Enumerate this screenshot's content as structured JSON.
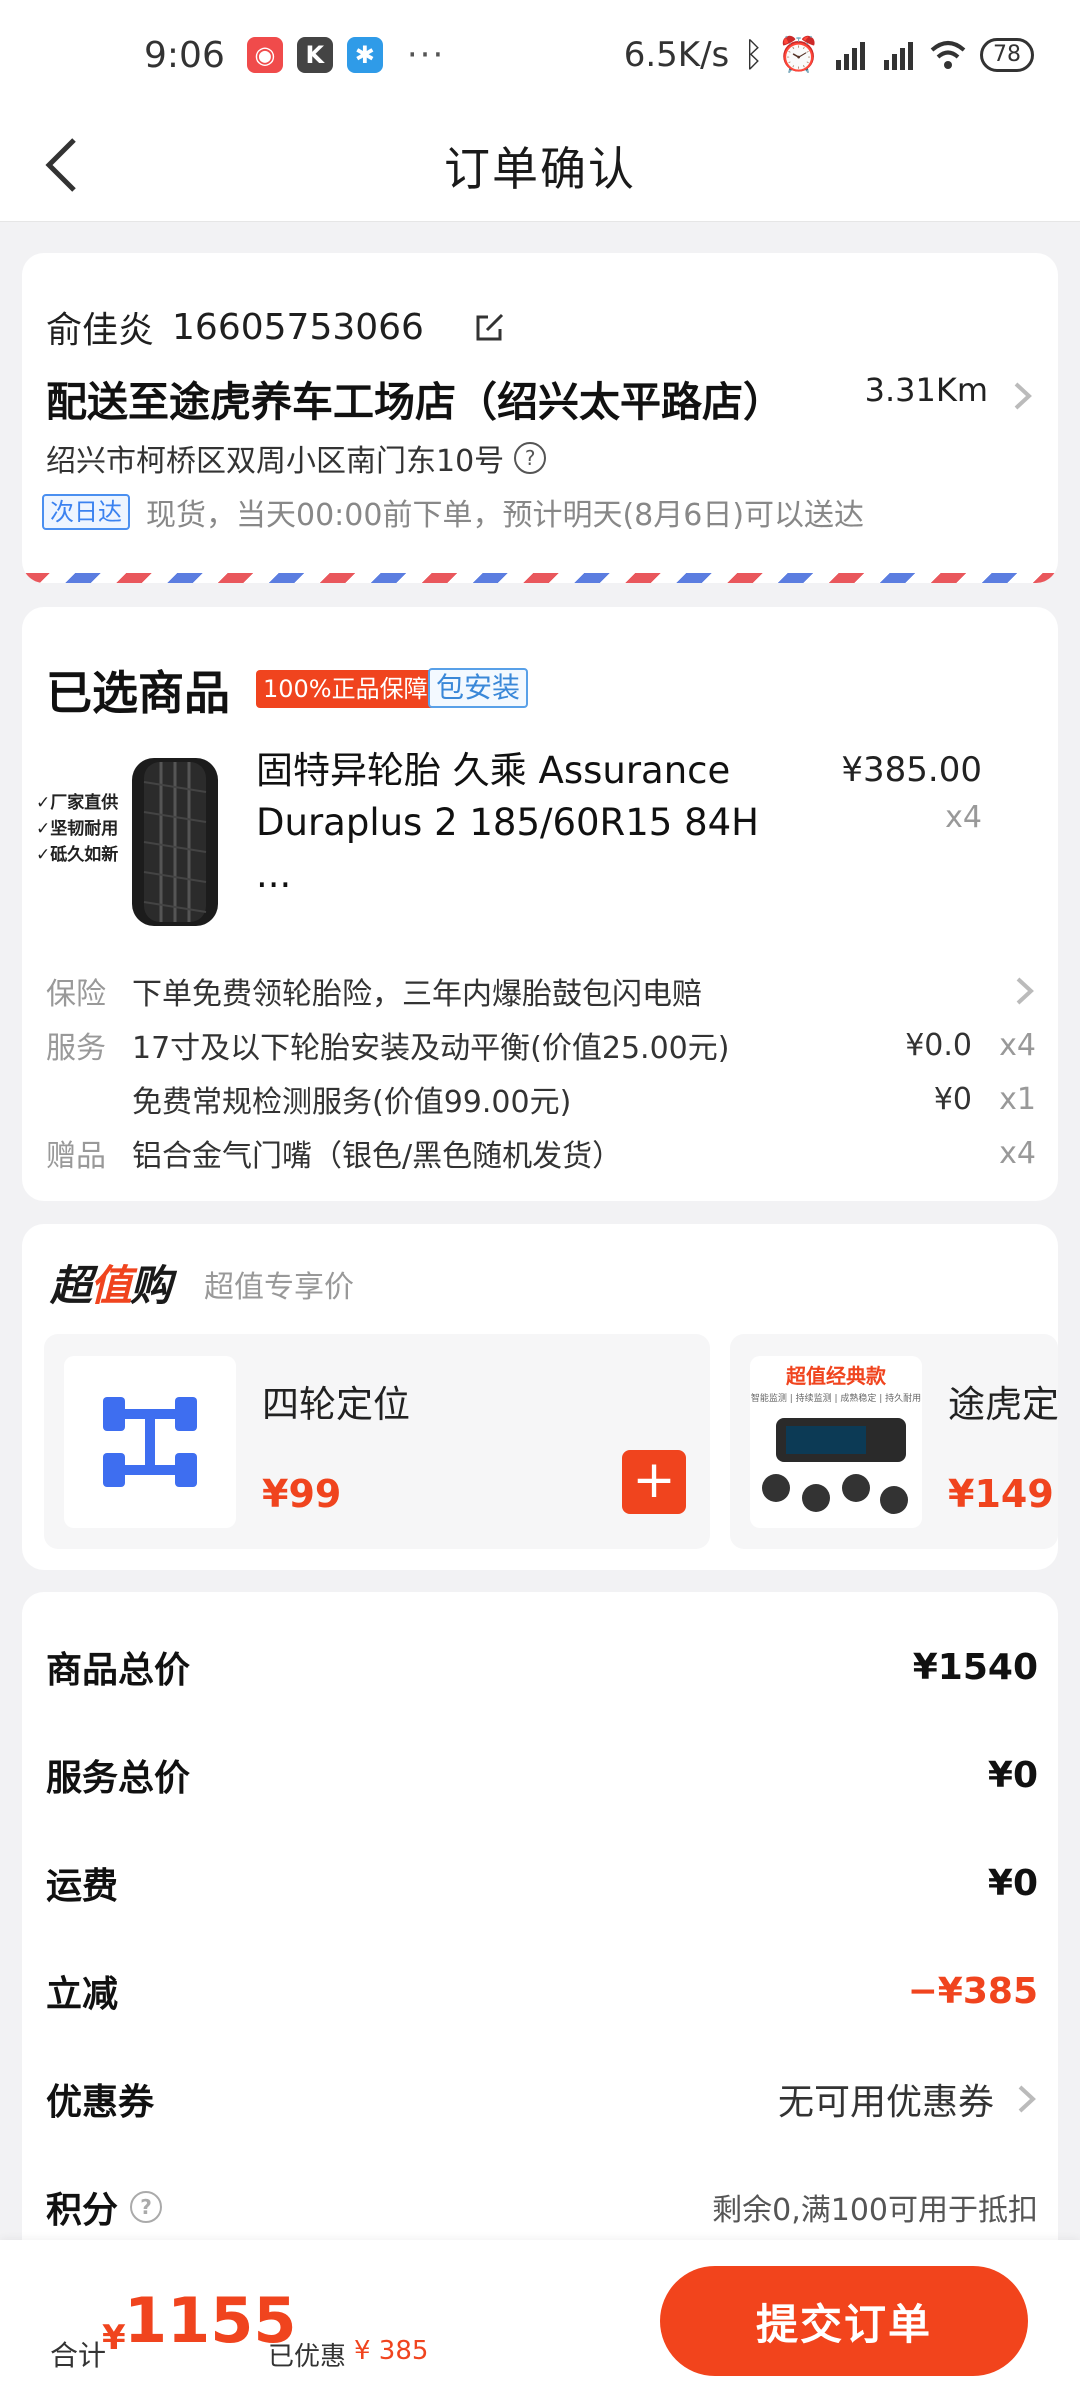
{
  "status_bar": {
    "time": "9:06",
    "network_speed": "6.5K/s",
    "battery": "78",
    "more": "···"
  },
  "nav": {
    "title": "订单确认"
  },
  "address": {
    "name": "俞佳炎",
    "phone": "16605753066",
    "store": "配送至途虎养车工场店（绍兴太平路店）",
    "distance": "3.31Km",
    "detail": "绍兴市柯桥区双周小区南门东10号",
    "delivery_tag": "次日达",
    "delivery_note": "现货，当天00:00前下单，预计明天(8月6日)可以送达"
  },
  "products": {
    "title": "已选商品",
    "tag_genuine": "100%正品保障",
    "tag_install": "包安装",
    "item": {
      "image_tags": [
        "✓厂家直供",
        "✓坚韧耐用",
        "✓砥久如新"
      ],
      "name": "固特异轮胎 久乘 Assurance Duraplus 2 185/60R15 84H ...",
      "price": "¥385.00",
      "qty": "x4"
    },
    "insurance_label": "保险",
    "insurance_text": "下单免费领轮胎险，三年内爆胎鼓包闪电赔",
    "service_label": "服务",
    "service_1_text": "17寸及以下轮胎安装及动平衡(价值25.00元)",
    "service_1_amount": "¥0.0",
    "service_1_qty": "x4",
    "service_2_text": "免费常规检测服务(价值99.00元)",
    "service_2_amount": "¥0",
    "service_2_qty": "x1",
    "gift_label": "赠品",
    "gift_text": "铝合金气门嘴（银色/黑色随机发货）",
    "gift_qty": "x4"
  },
  "super_value": {
    "logo_part1": "超",
    "logo_part2": "值",
    "logo_part3": "购",
    "subtitle": "超值专享价",
    "items": [
      {
        "name": "四轮定位",
        "price": "¥99",
        "icon": "wheel-alignment-icon"
      },
      {
        "name": "途虎定",
        "price": "¥149",
        "image_banner": "超值经典款",
        "image_sub": "智能监测 | 持续监测 | 成熟稳定 | 持久耐用"
      }
    ]
  },
  "summary": {
    "goods_total_label": "商品总价",
    "goods_total": "¥1540",
    "service_total_label": "服务总价",
    "service_total": "¥0",
    "shipping_label": "运费",
    "shipping": "¥0",
    "discount_label": "立减",
    "discount": "−¥385",
    "coupon_label": "优惠券",
    "coupon_value": "无可用优惠券",
    "points_label": "积分",
    "points_value": "剩余0,满100可用于抵扣"
  },
  "bottom": {
    "total_label": "合计",
    "currency": "¥",
    "total_amount": "1155",
    "saved_label": "已优惠",
    "saved_amount": "¥ 385",
    "submit_label": "提交订单"
  },
  "colors": {
    "accent": "#f0441e",
    "background": "#f2f2f4",
    "blue_tag": "#3b82f0"
  }
}
